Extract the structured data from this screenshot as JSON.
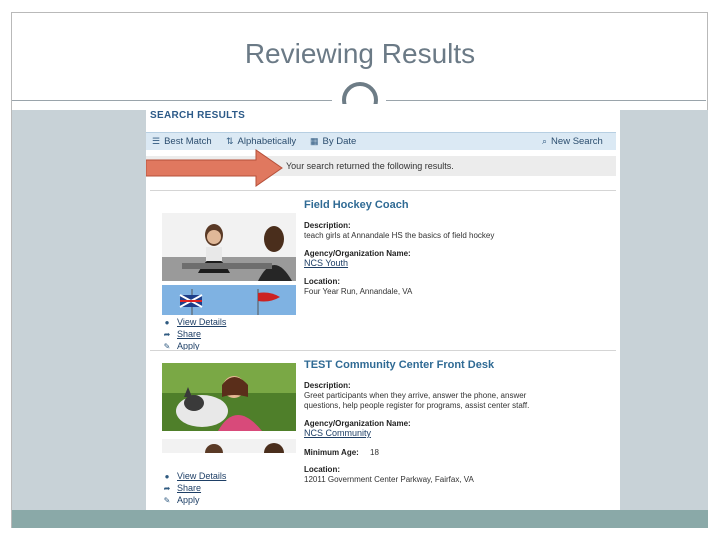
{
  "slide": {
    "title": "Reviewing Results"
  },
  "results_page": {
    "header": "SEARCH RESULTS",
    "sort": {
      "best_match": "Best Match",
      "alphabetically": "Alphabetically",
      "by_date": "By Date",
      "new_search": "New Search"
    },
    "message": "Your search returned the following results.",
    "results": [
      {
        "title": "Field Hockey Coach",
        "description_label": "Description:",
        "description": "teach girls at Annandale HS the basics of field hockey",
        "agency_label": "Agency/Organization Name:",
        "agency": "NCS Youth",
        "location_label": "Location:",
        "location": "Four Year Run, Annandale, VA",
        "actions": [
          "View Details",
          "Share",
          "Apply"
        ]
      },
      {
        "title": "TEST Community Center Front Desk",
        "description_label": "Description:",
        "description_line1": "Greet participants when they arrive, answer the phone, answer",
        "description_line2": "questions, help people register for programs, assist center staff.",
        "agency_label": "Agency/Organization Name:",
        "agency": "NCS Community",
        "min_age_label": "Minimum Age:",
        "min_age": "18",
        "location_label": "Location:",
        "location": "12011 Government Center Parkway, Fairfax, VA",
        "actions": [
          "View Details",
          "Share",
          "Apply"
        ]
      }
    ]
  },
  "colors": {
    "accent": "#2f6a94",
    "arrow": "#e0785f",
    "panel": "#c8d2d7"
  }
}
